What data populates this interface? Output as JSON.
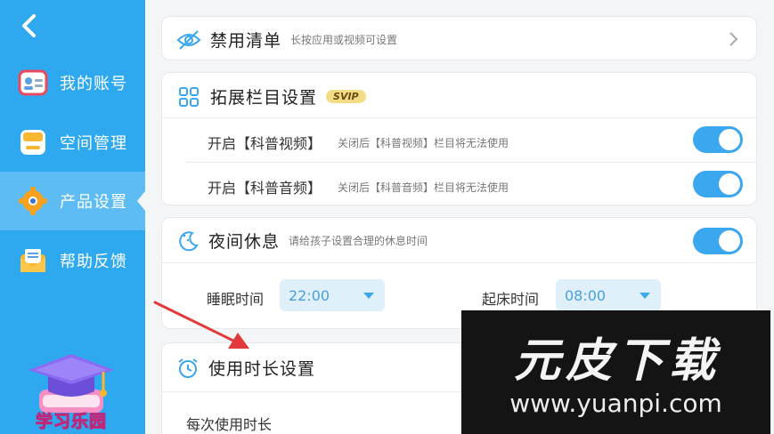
{
  "sidebar": {
    "items": [
      {
        "label": "我的账号",
        "icon": "account-card-icon"
      },
      {
        "label": "空间管理",
        "icon": "storage-icon"
      },
      {
        "label": "产品设置",
        "icon": "gear-icon",
        "active": true
      },
      {
        "label": "帮助反馈",
        "icon": "mail-icon"
      }
    ],
    "promo_label": "学习乐园"
  },
  "blocklist": {
    "title": "禁用清单",
    "subtitle": "长按应用或视频可设置"
  },
  "extension": {
    "title": "拓展栏目设置",
    "badge": "SVIP",
    "rows": [
      {
        "label": "开启【科普视频】",
        "hint": "关闭后【科普视频】栏目将无法使用",
        "enabled": true
      },
      {
        "label": "开启【科普音频】",
        "hint": "关闭后【科普音频】栏目将无法使用",
        "enabled": true
      }
    ]
  },
  "night_rest": {
    "title": "夜间休息",
    "subtitle": "请给孩子设置合理的休息时间",
    "enabled": true,
    "sleep_label": "睡眠时间",
    "sleep_value": "22:00",
    "wake_label": "起床时间",
    "wake_value": "08:00"
  },
  "usage": {
    "title": "使用时长设置",
    "per_use_label": "每次使用时长"
  },
  "watermark": {
    "brand": "元皮下载",
    "url": "www.yuanpi.com"
  },
  "colors": {
    "sidebar": "#2ea8ef",
    "accent": "#3aa7ee",
    "arrow": "#e23a3a",
    "watermark_green": "#73c31a"
  }
}
